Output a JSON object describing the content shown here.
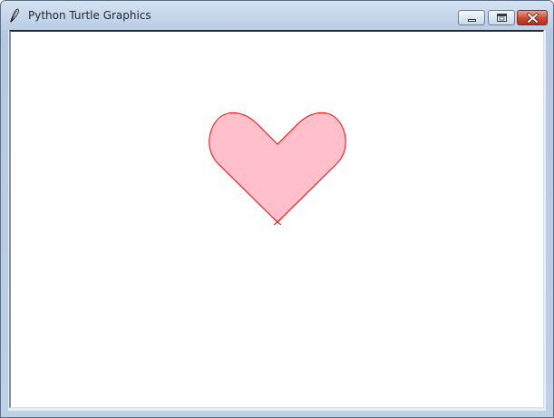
{
  "window": {
    "title": "Python Turtle Graphics",
    "icon": "feather-icon",
    "controls": [
      "minimize-icon",
      "maximize-icon",
      "close-icon"
    ]
  },
  "canvas": {
    "background": "#ffffff",
    "shape": "heart",
    "fill_color": "#ffc0cb",
    "pen_color": "#ff0000",
    "turtle_cursor": "classic-arrow"
  }
}
